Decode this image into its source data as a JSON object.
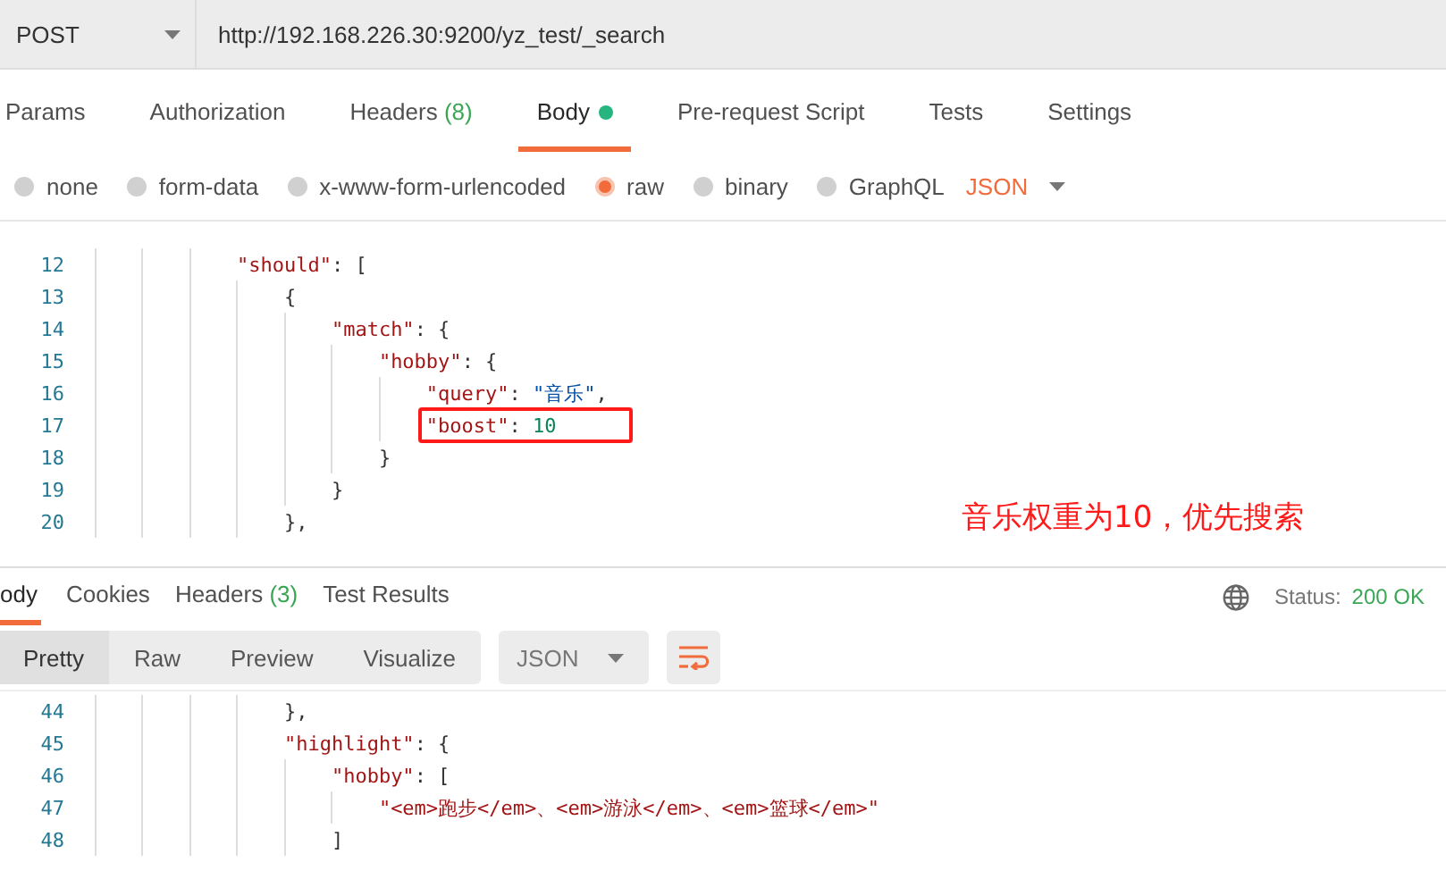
{
  "request": {
    "method": "POST",
    "url": "http://192.168.226.30:9200/yz_test/_search"
  },
  "request_tabs": [
    {
      "label": "Params",
      "selected": false
    },
    {
      "label": "Authorization",
      "selected": false
    },
    {
      "label": "Headers",
      "count": "(8)",
      "selected": false
    },
    {
      "label": "Body",
      "dot": true,
      "selected": true
    },
    {
      "label": "Pre-request Script",
      "selected": false
    },
    {
      "label": "Tests",
      "selected": false
    },
    {
      "label": "Settings",
      "selected": false
    }
  ],
  "body_types": [
    {
      "label": "none",
      "selected": false
    },
    {
      "label": "form-data",
      "selected": false
    },
    {
      "label": "x-www-form-urlencoded",
      "selected": false
    },
    {
      "label": "raw",
      "selected": true
    },
    {
      "label": "binary",
      "selected": false
    },
    {
      "label": "GraphQL",
      "selected": false
    }
  ],
  "body_format": "JSON",
  "request_lines": [
    {
      "number": "12",
      "tokens": [
        {
          "kind": "key",
          "text": "            \"should\""
        },
        {
          "kind": "punct",
          "text": ": ["
        }
      ]
    },
    {
      "number": "13",
      "tokens": [
        {
          "kind": "punct",
          "text": "                {"
        }
      ]
    },
    {
      "number": "14",
      "tokens": [
        {
          "kind": "key",
          "text": "                    \"match\""
        },
        {
          "kind": "punct",
          "text": ": {"
        }
      ]
    },
    {
      "number": "15",
      "tokens": [
        {
          "kind": "key",
          "text": "                        \"hobby\""
        },
        {
          "kind": "punct",
          "text": ": {"
        }
      ]
    },
    {
      "number": "16",
      "tokens": [
        {
          "kind": "key",
          "text": "                            \"query\""
        },
        {
          "kind": "punct",
          "text": ": "
        },
        {
          "kind": "string",
          "text": "\"音乐\""
        },
        {
          "kind": "punct",
          "text": ","
        }
      ]
    },
    {
      "number": "17",
      "boxed": true,
      "tokens": [
        {
          "kind": "key",
          "text": "                            \"boost\""
        },
        {
          "kind": "punct",
          "text": ": "
        },
        {
          "kind": "number",
          "text": "10"
        }
      ]
    },
    {
      "number": "18",
      "tokens": [
        {
          "kind": "punct",
          "text": "                        }"
        }
      ]
    },
    {
      "number": "19",
      "tokens": [
        {
          "kind": "punct",
          "text": "                    }"
        }
      ]
    },
    {
      "number": "20",
      "tokens": [
        {
          "kind": "punct",
          "text": "                },"
        }
      ]
    }
  ],
  "annotation": "音乐权重为10，优先搜索",
  "response_tabs": [
    {
      "label": "ody",
      "selected": true
    },
    {
      "label": "Cookies",
      "selected": false
    },
    {
      "label": "Headers",
      "count": "(3)",
      "selected": false
    },
    {
      "label": "Test Results",
      "selected": false
    }
  ],
  "status": {
    "label": "Status:",
    "value": "200 OK"
  },
  "view_modes": [
    {
      "label": "Pretty",
      "selected": true
    },
    {
      "label": "Raw",
      "selected": false
    },
    {
      "label": "Preview",
      "selected": false
    },
    {
      "label": "Visualize",
      "selected": false
    }
  ],
  "response_format": "JSON",
  "response_lines": [
    {
      "number": "44",
      "tokens": [
        {
          "kind": "punct",
          "text": "                },"
        }
      ]
    },
    {
      "number": "45",
      "tokens": [
        {
          "kind": "key",
          "text": "                \"highlight\""
        },
        {
          "kind": "punct",
          "text": ": {"
        }
      ]
    },
    {
      "number": "46",
      "tokens": [
        {
          "kind": "key",
          "text": "                    \"hobby\""
        },
        {
          "kind": "punct",
          "text": ": ["
        }
      ]
    },
    {
      "number": "47",
      "tokens": [
        {
          "kind": "key",
          "text": "                        \"<em>跑步</em>、<em>游泳</em>、<em>篮球</em>\""
        }
      ]
    },
    {
      "number": "48",
      "tokens": [
        {
          "kind": "punct",
          "text": "                    ]"
        }
      ]
    }
  ]
}
